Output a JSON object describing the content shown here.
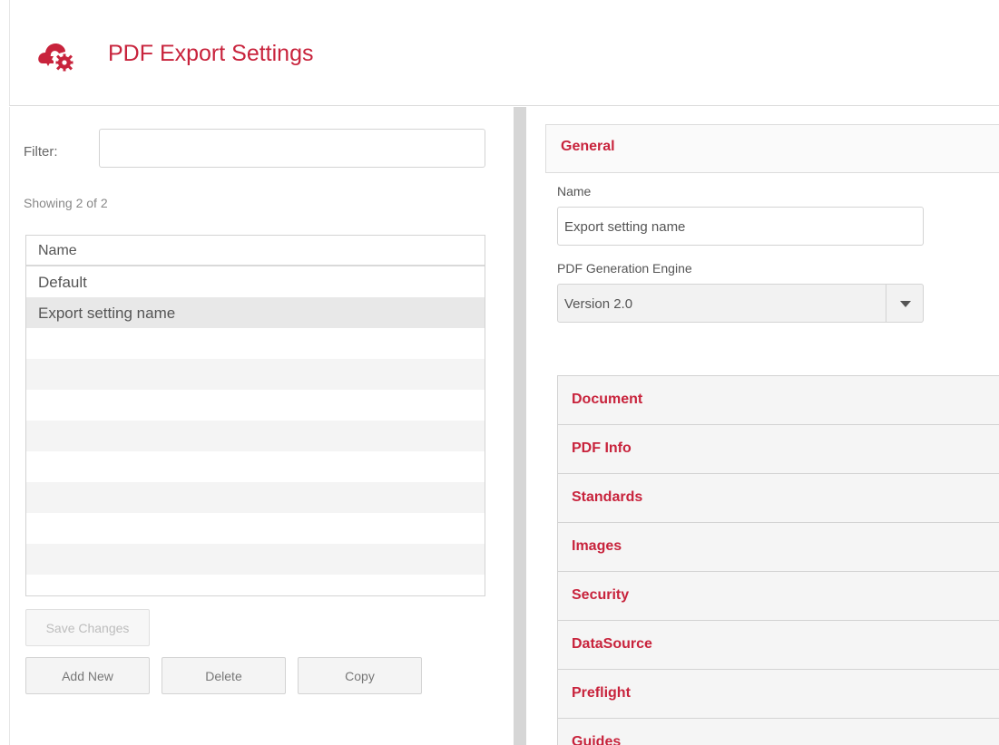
{
  "header": {
    "title": "PDF Export Settings",
    "logo_icon": "cloud-gear-icon",
    "accent_color": "#c8233c"
  },
  "filter": {
    "label": "Filter:",
    "value": "",
    "placeholder": ""
  },
  "list": {
    "showing": "Showing 2 of 2",
    "column_header": "Name",
    "rows": [
      "Default",
      "Export setting name"
    ],
    "selected_index": 1
  },
  "buttons": {
    "save": "Save Changes",
    "add": "Add New",
    "delete": "Delete",
    "copy": "Copy"
  },
  "general": {
    "section_title": "General",
    "name_label": "Name",
    "name_value": "Export setting name",
    "engine_label": "PDF Generation Engine",
    "engine_value": "Version 2.0"
  },
  "sections": [
    "Document",
    "PDF Info",
    "Standards",
    "Images",
    "Security",
    "DataSource",
    "Preflight",
    "Guides"
  ]
}
